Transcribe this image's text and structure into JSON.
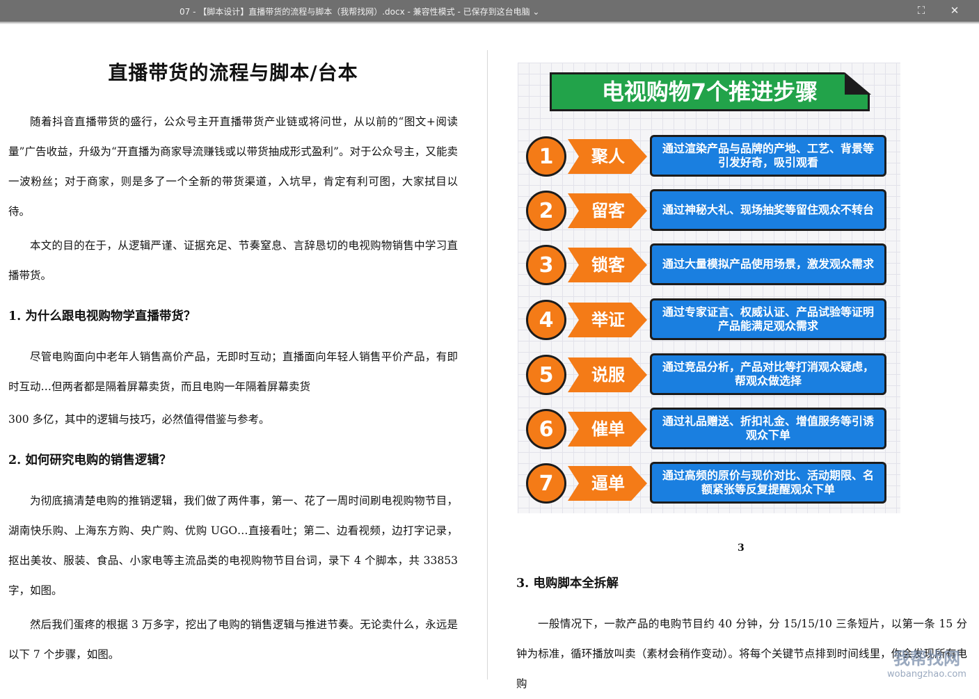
{
  "window": {
    "title": "07 - 【脚本设计】直播带货的流程与脚本（我帮找网）.docx  -  兼容性模式  -  已保存到这台电脑 ⌄",
    "fullscreen_icon": "fullscreen-icon",
    "close_icon": "close-icon"
  },
  "left": {
    "title": "直播带货的流程与脚本/台本",
    "p1": "随着抖音直播带货的盛行，公众号主开直播带货产业链或将问世，从以前的“图文+阅读量”广告收益，升级为“开直播为商家导流赚钱或以带货抽成形式盈利”。对于公众号主，又能卖一波粉丝；对于商家，则是多了一个全新的带货渠道，入坑早，肯定有利可图，大家拭目以待。",
    "p2": "本文的目的在于，从逻辑严谨、证据充足、节奏窒息、言辞恳切的电视购物销售中学习直播带货。",
    "h1": "1. 为什么跟电视购物学直播带货？",
    "p3": "尽管电购面向中老年人销售高价产品，无即时互动；直播面向年轻人销售平价产品，有即时互动…但两者都是隔着屏幕卖货，而且电购一年隔着屏幕卖货",
    "p4": "300 多亿，其中的逻辑与技巧，必然值得借鉴与参考。",
    "h2": "2. 如何研究电购的销售逻辑？",
    "p5": "为彻底搞清楚电购的推销逻辑，我们做了两件事，第一、花了一周时间刷电视购物节目，湖南快乐购、上海东方购、央广购、优购 UGO…直接看吐；第二、边看视频，边打字记录，抠出美妆、服装、食品、小家电等主流品类的电视购物节目台词，录下 4 个脚本，共 33853 字，如图。",
    "p6": "然后我们蛋疼的根据 3 万多字，挖出了电购的销售逻辑与推进节奏。无论卖什么，永远是以下 7 个步骤，如图。"
  },
  "infographic": {
    "banner": "电视购物7个推进步骤",
    "steps": [
      {
        "num": "1",
        "name": "聚人",
        "desc": "通过渲染产品与品牌的产地、工艺、背景等引发好奇，吸引观看"
      },
      {
        "num": "2",
        "name": "留客",
        "desc": "通过神秘大礼、现场抽奖等留住观众不转台"
      },
      {
        "num": "3",
        "name": "锁客",
        "desc": "通过大量模拟产品使用场景，激发观众需求"
      },
      {
        "num": "4",
        "name": "举证",
        "desc": "通过专家证言、权威认证、产品试验等证明产品能满足观众需求"
      },
      {
        "num": "5",
        "name": "说服",
        "desc": "通过竞品分析，产品对比等打消观众疑虑，帮观众做选择"
      },
      {
        "num": "6",
        "name": "催单",
        "desc": "通过礼品赠送、折扣礼金、增值服务等引诱观众下单"
      },
      {
        "num": "7",
        "name": "逼单",
        "desc": "通过高频的原价与现价对比、活动期限、名额紧张等反复提醒观众下单"
      }
    ],
    "colors": {
      "orange": "#f47b17",
      "blue": "#1a7fe0",
      "green": "#22a34a"
    }
  },
  "right": {
    "page_number": "3",
    "h3": "3. 电购脚本全拆解",
    "p7": "一般情况下，一款产品的电购节目约 40 分钟，分 15/15/10 三条短片，以第一条 15 分钟为标准，循环播放叫卖（素材会稍作变动）。将每个关键节点排到时间线里，你会发现所有电购"
  },
  "watermark": {
    "line1": "我帮找网",
    "line2": "wobangzhao.com"
  }
}
